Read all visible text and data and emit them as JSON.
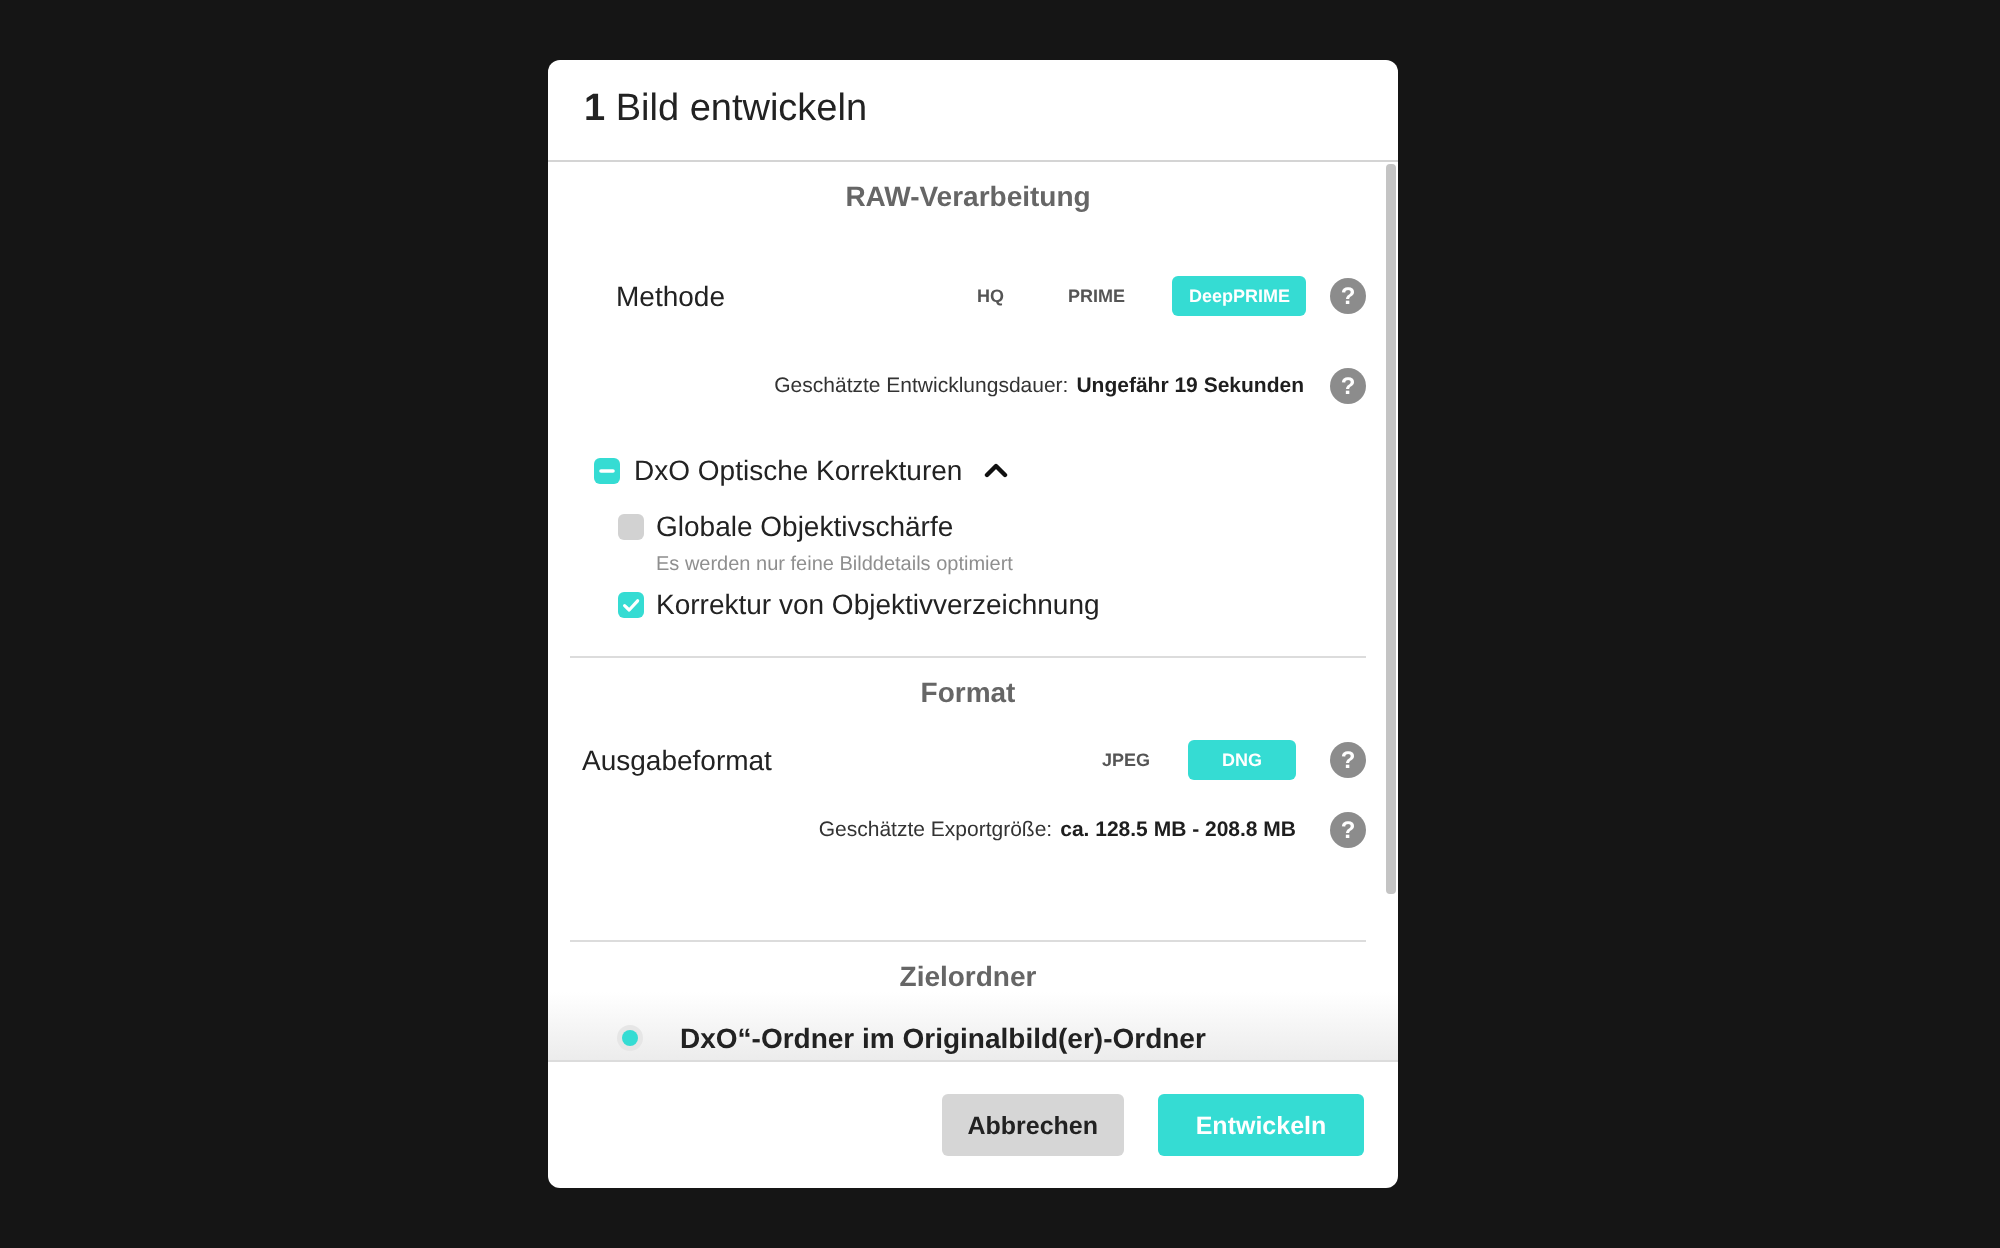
{
  "header": {
    "title": "**1** Bild entwickeln"
  },
  "raw_processing": {
    "heading": "RAW-Verarbeitung",
    "method": {
      "label": "Methode",
      "options": [
        {
          "label": "HQ",
          "selected": false
        },
        {
          "label": "PRIME",
          "selected": false
        },
        {
          "label": "DeepPRIME",
          "selected": true
        }
      ],
      "help": "?"
    },
    "duration": {
      "label": "Geschätzte Entwicklungsdauer:",
      "value": "Ungefähr 19 Sekunden",
      "help": "?"
    },
    "optical_corrections": {
      "label": "DxO Optische Korrekturen",
      "checked": true,
      "partial": true,
      "expanded": true,
      "children": [
        {
          "label": "Globale Objektivschärfe",
          "checked": false,
          "hint": "Es werden nur feine Bilddetails optimiert"
        },
        {
          "label": "Korrektur von Objektivverzeichnung",
          "checked": true
        }
      ]
    }
  },
  "format": {
    "heading": "Format",
    "output_format": {
      "label": "Ausgabeformat",
      "options": [
        {
          "label": "JPEG",
          "selected": false
        },
        {
          "label": "DNG",
          "selected": true
        }
      ],
      "help": "?"
    },
    "export_size": {
      "label": "Geschätzte Exportgröße:",
      "value": "ca. 128.5 MB - 208.8 MB",
      "help": "?"
    }
  },
  "destination": {
    "heading": "Zielordner",
    "options": [
      {
        "label": "DxO“-Ordner im Originalbild(er)-Ordner",
        "selected": true
      }
    ]
  },
  "buttons": [
    {
      "label": "Abbrechen",
      "kind": "secondary"
    },
    {
      "label": "Entwickeln",
      "kind": "primary"
    }
  ]
}
